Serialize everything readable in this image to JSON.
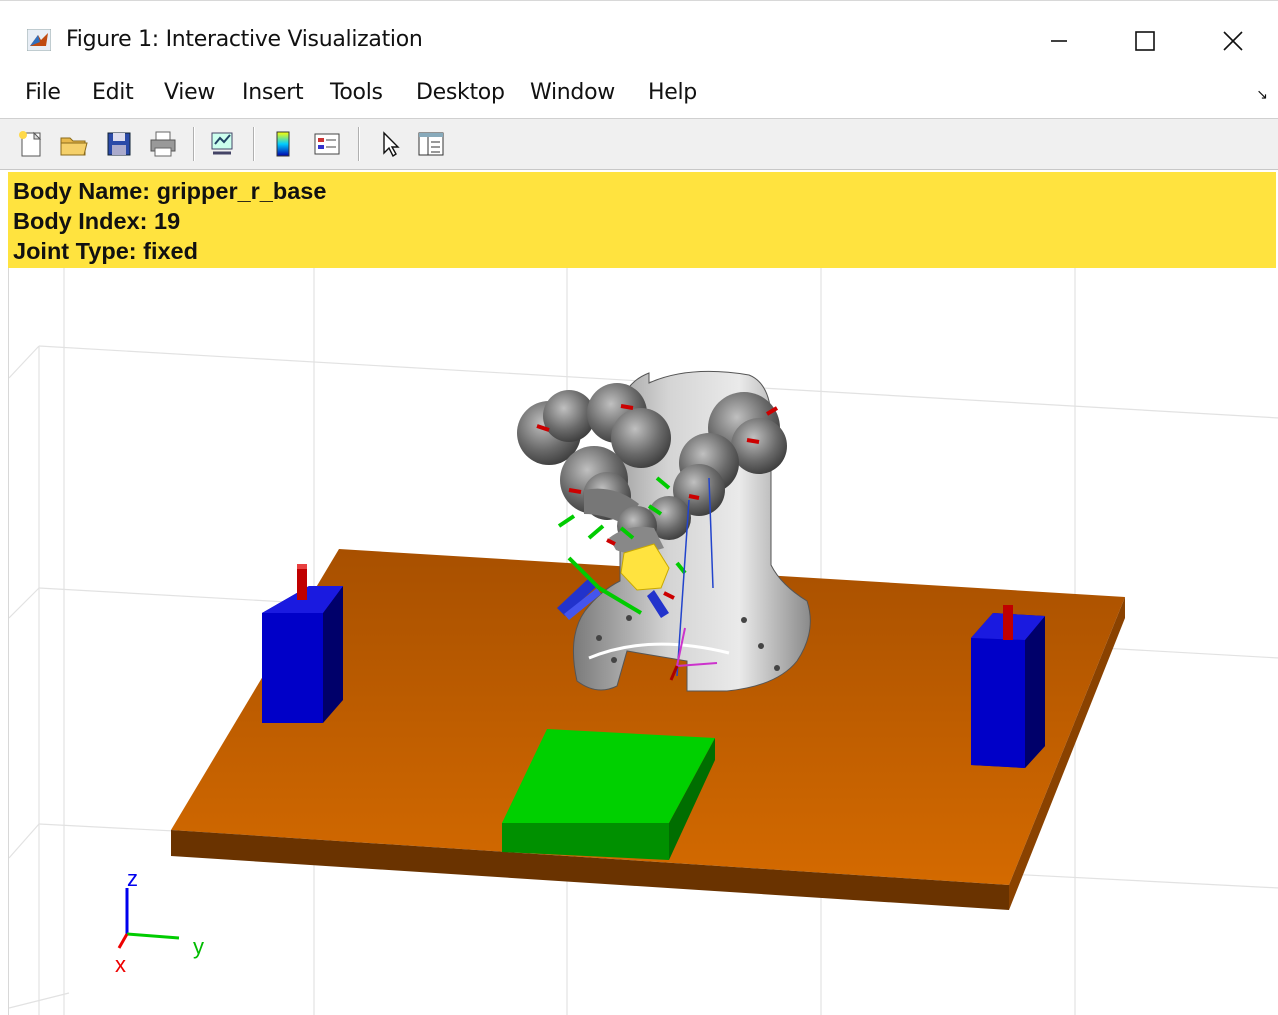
{
  "window": {
    "title": "Figure 1: Interactive Visualization"
  },
  "menu": {
    "items": [
      "File",
      "Edit",
      "View",
      "Insert",
      "Tools",
      "Desktop",
      "Window",
      "Help"
    ]
  },
  "toolbar": {
    "buttons": [
      "new-figure",
      "open-file",
      "save-figure",
      "print-figure",
      "link-plot",
      "insert-colorbar",
      "insert-legend",
      "edit-plot",
      "open-property-inspector"
    ]
  },
  "info": {
    "body_name": "Body Name: gripper_r_base",
    "body_index": "Body Index: 19",
    "joint_type": "Joint Type: fixed"
  },
  "axes_triad": {
    "x_label": "x",
    "y_label": "y",
    "z_label": "z"
  },
  "colors": {
    "highlight": "#ffe33f",
    "table": "#c96400",
    "box": "#0000aa",
    "target": "#00cc00"
  }
}
